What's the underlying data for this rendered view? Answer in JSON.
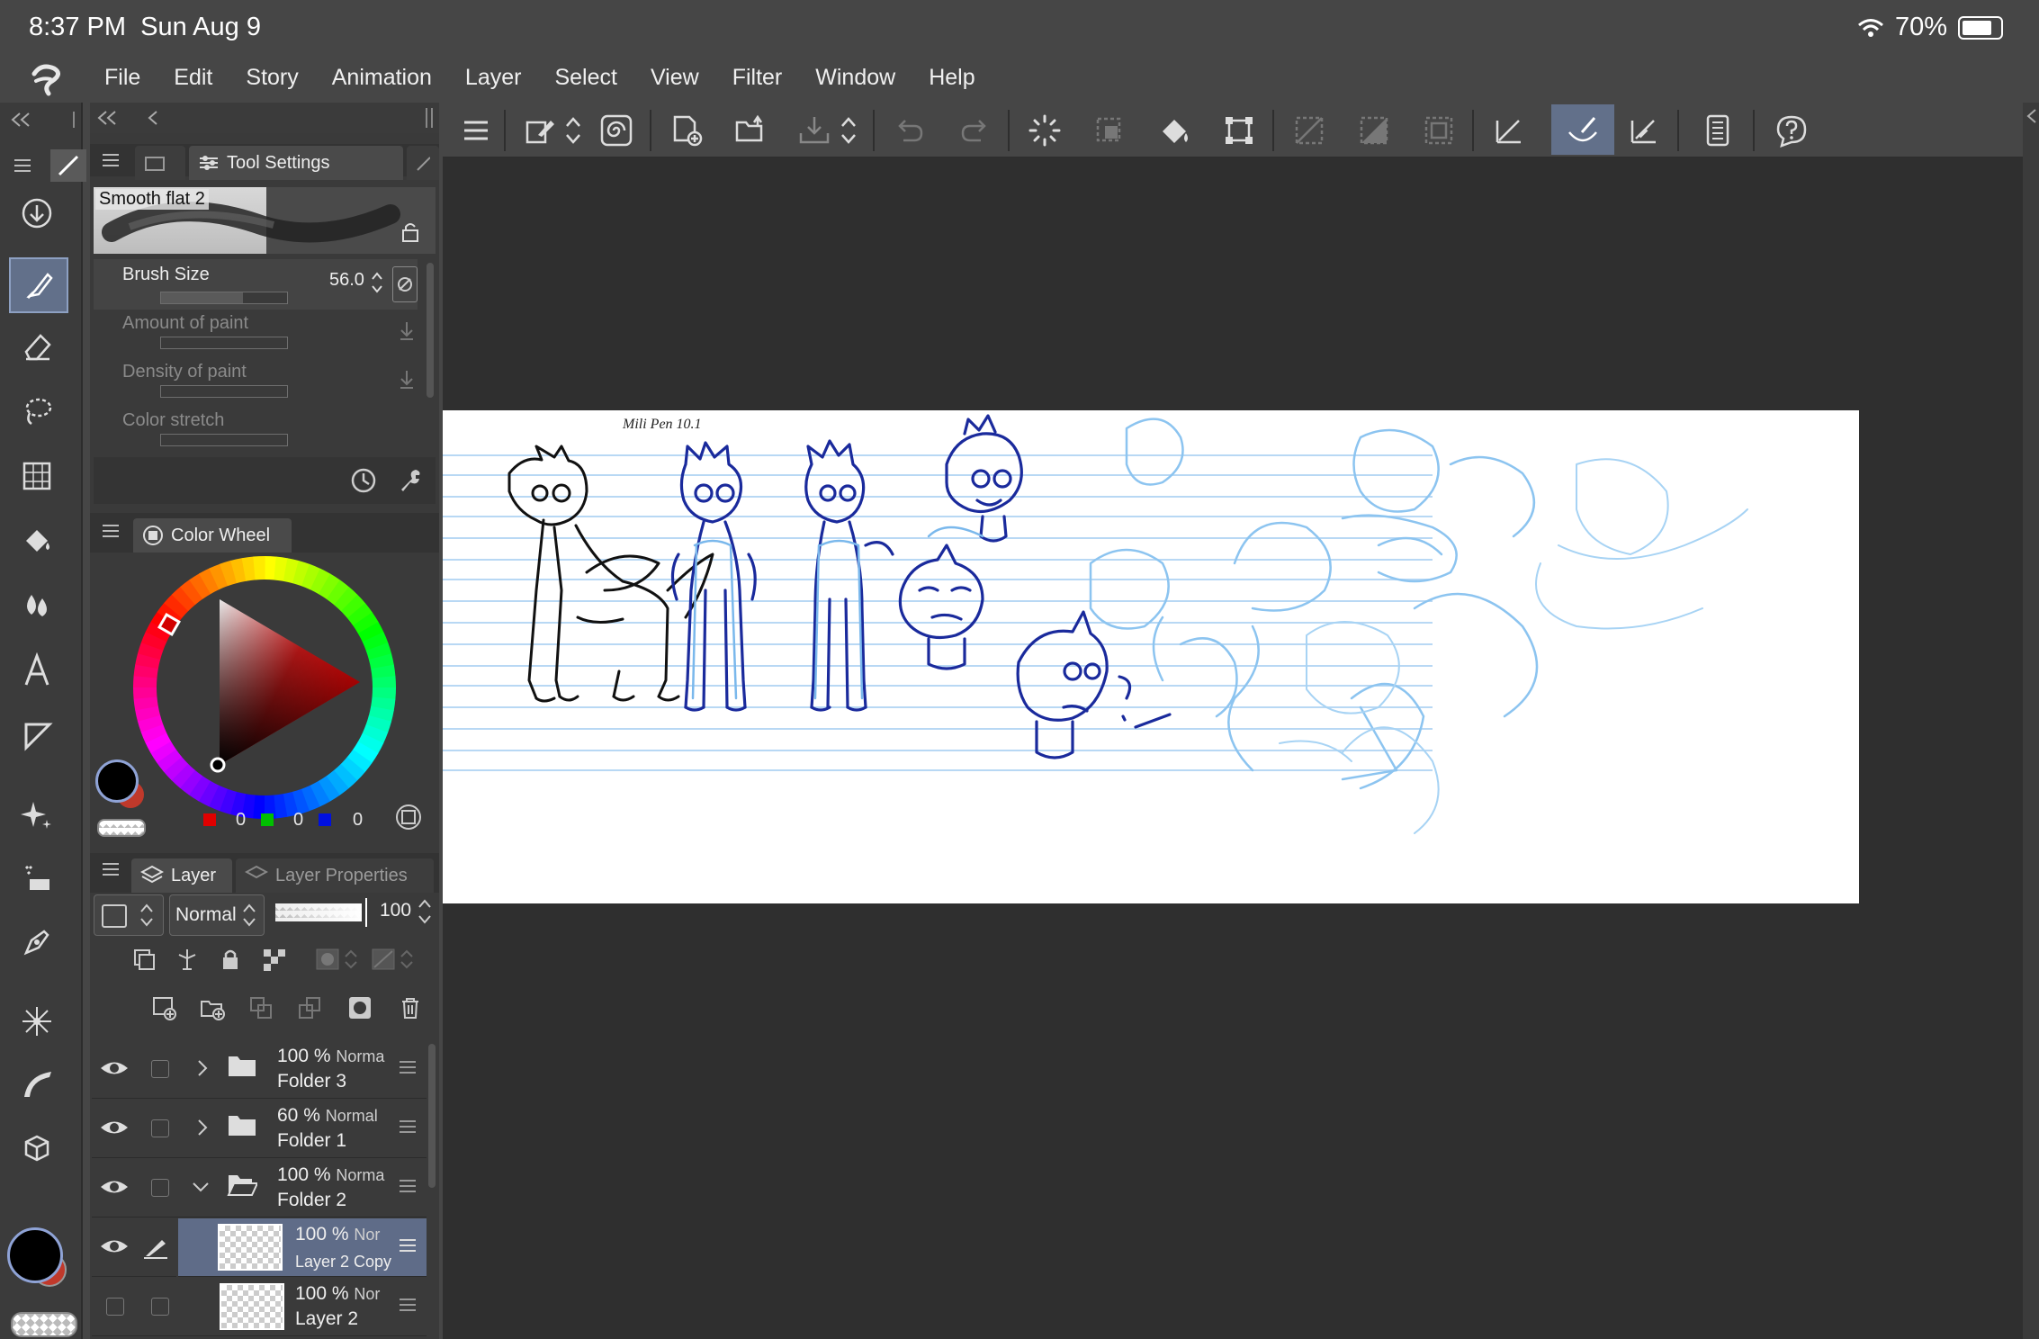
{
  "status": {
    "time": "8:37 PM",
    "date": "Sun Aug 9",
    "battery": "70%"
  },
  "menu": [
    "File",
    "Edit",
    "Story",
    "Animation",
    "Layer",
    "Select",
    "View",
    "Filter",
    "Window",
    "Help"
  ],
  "tool_settings": {
    "tab": "Tool Settings",
    "brush_name": "Smooth flat 2",
    "brush_size_label": "Brush Size",
    "brush_size_value": "56.0",
    "amount_label": "Amount of paint",
    "density_label": "Density of paint",
    "stretch_label": "Color stretch"
  },
  "color_wheel": {
    "tab": "Color Wheel",
    "r": "0",
    "g": "0",
    "b": "0",
    "main_color": "#000000",
    "sub_color": "#c0392b"
  },
  "layer_panel": {
    "tab_layer": "Layer",
    "tab_props": "Layer Properties",
    "blend_mode": "Normal",
    "opacity": "100",
    "layers": [
      {
        "pct": "100 %",
        "mode": "Norma",
        "name": "Folder 3",
        "type": "folder-closed",
        "visible": true
      },
      {
        "pct": "60 %",
        "mode": "Normal",
        "name": "Folder 1",
        "type": "folder-closed",
        "visible": true
      },
      {
        "pct": "100 %",
        "mode": "Norma",
        "name": "Folder 2",
        "type": "folder-open",
        "visible": true
      },
      {
        "pct": "100 %",
        "mode": "Nor",
        "name": "Layer 2 Copy",
        "type": "raster",
        "visible": true,
        "selected": true
      },
      {
        "pct": "100 %",
        "mode": "Nor",
        "name": "Layer 2",
        "type": "raster",
        "visible": false
      }
    ]
  },
  "canvas": {
    "note_text": "Mili Pen 10.1",
    "sketch_color_dark": "#1a2a9c",
    "sketch_color_light": "#7ab8ec"
  }
}
